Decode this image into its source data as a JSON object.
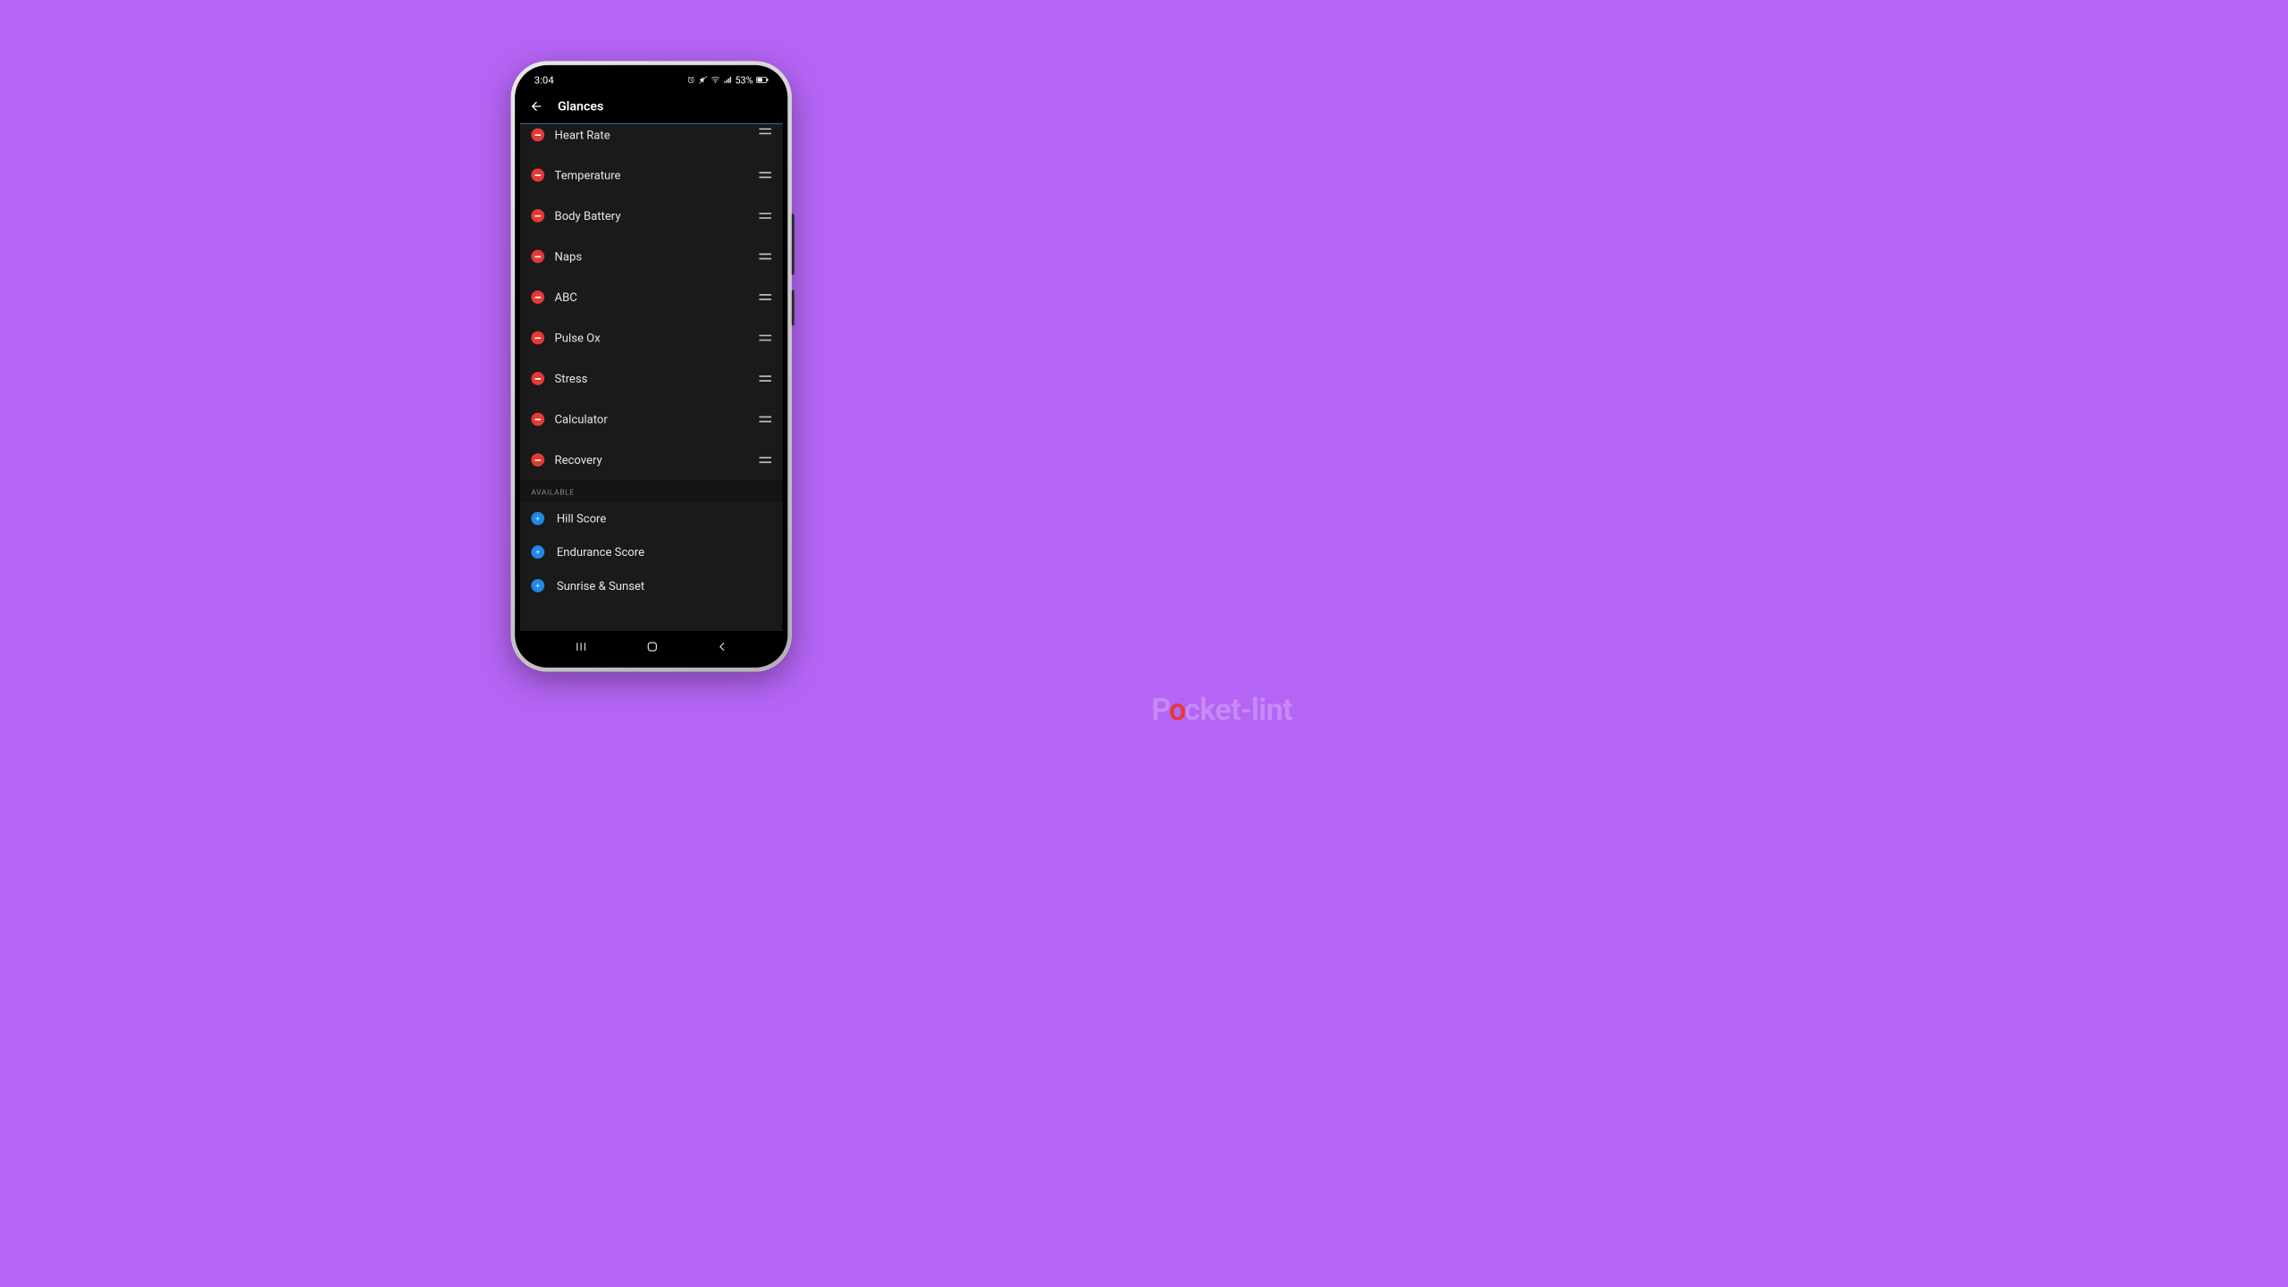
{
  "watermark": {
    "prefix": "P",
    "accent": "o",
    "suffix": "cket-lint"
  },
  "status": {
    "time": "3:04",
    "battery_text": "53%"
  },
  "appbar": {
    "title": "Glances"
  },
  "active_glances": [
    {
      "label": "Heart Rate"
    },
    {
      "label": "Temperature"
    },
    {
      "label": "Body Battery"
    },
    {
      "label": "Naps"
    },
    {
      "label": "ABC"
    },
    {
      "label": "Pulse Ox"
    },
    {
      "label": "Stress"
    },
    {
      "label": "Calculator"
    },
    {
      "label": "Recovery"
    }
  ],
  "section_available_label": "AVAILABLE",
  "available_glances": [
    {
      "label": "Hill Score"
    },
    {
      "label": "Endurance Score"
    },
    {
      "label": "Sunrise & Sunset"
    }
  ]
}
